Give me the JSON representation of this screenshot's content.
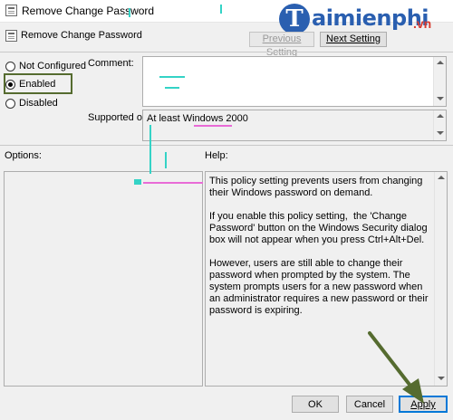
{
  "window": {
    "title": "Remove Change Password",
    "icon": "policy-icon"
  },
  "watermark": {
    "letter": "T",
    "text": "aimienphi",
    "suffix": ".vn"
  },
  "header": {
    "setting_name": "Remove Change Password",
    "previous_label": "Previous Setting",
    "next_label": "Next Setting"
  },
  "state": {
    "options": [
      {
        "label": "Not Configured",
        "checked": false
      },
      {
        "label": "Enabled",
        "checked": true
      },
      {
        "label": "Disabled",
        "checked": false
      }
    ]
  },
  "comment": {
    "label": "Comment:",
    "value": ""
  },
  "supported": {
    "label": "Supported on:",
    "value": "At least Windows 2000"
  },
  "options_panel": {
    "label": "Options:"
  },
  "help": {
    "label": "Help:",
    "paragraphs": [
      "This policy setting prevents users from changing their Windows password on demand.",
      "If you enable this policy setting,  the 'Change Password' button on the Windows Security dialog box will not appear when you press Ctrl+Alt+Del.",
      "However, users are still able to change their password when prompted by the system. The system prompts users for a new password when an administrator requires a new password or their password is expiring."
    ]
  },
  "footer": {
    "ok_label": "OK",
    "cancel_label": "Cancel",
    "apply_label": "Apply"
  },
  "colors": {
    "annotation_highlight": "#556b2f",
    "focus_border": "#0078d7",
    "watermark_blue": "#2a5fb0",
    "watermark_red": "#d83b2f"
  }
}
